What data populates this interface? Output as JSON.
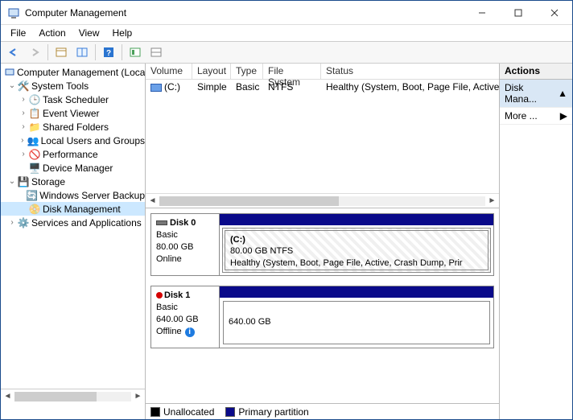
{
  "window": {
    "title": "Computer Management"
  },
  "menubar": [
    "File",
    "Action",
    "View",
    "Help"
  ],
  "tree": {
    "root": "Computer Management (Local",
    "systools": "System Tools",
    "systools_children": [
      "Task Scheduler",
      "Event Viewer",
      "Shared Folders",
      "Local Users and Groups",
      "Performance",
      "Device Manager"
    ],
    "storage": "Storage",
    "storage_children": [
      "Windows Server Backup",
      "Disk Management"
    ],
    "services": "Services and Applications"
  },
  "volume_table": {
    "headers": [
      "Volume",
      "Layout",
      "Type",
      "File System",
      "Status"
    ],
    "row": {
      "volume": "(C:)",
      "layout": "Simple",
      "type": "Basic",
      "fs": "NTFS",
      "status": "Healthy (System, Boot, Page File, Active, Crash Dum"
    }
  },
  "disks": {
    "d0": {
      "name": "Disk 0",
      "kind": "Basic",
      "size": "80.00 GB",
      "state": "Online",
      "part_label": "(C:)",
      "part_size": "80.00 GB NTFS",
      "part_status": "Healthy (System, Boot, Page File, Active, Crash Dump, Prir"
    },
    "d1": {
      "name": "Disk 1",
      "kind": "Basic",
      "size": "640.00 GB",
      "state": "Offline",
      "part_size": "640.00 GB"
    }
  },
  "legend": {
    "unalloc": "Unallocated",
    "primary": "Primary partition"
  },
  "actions": {
    "header": "Actions",
    "row1": "Disk Mana...",
    "row2": "More ..."
  }
}
